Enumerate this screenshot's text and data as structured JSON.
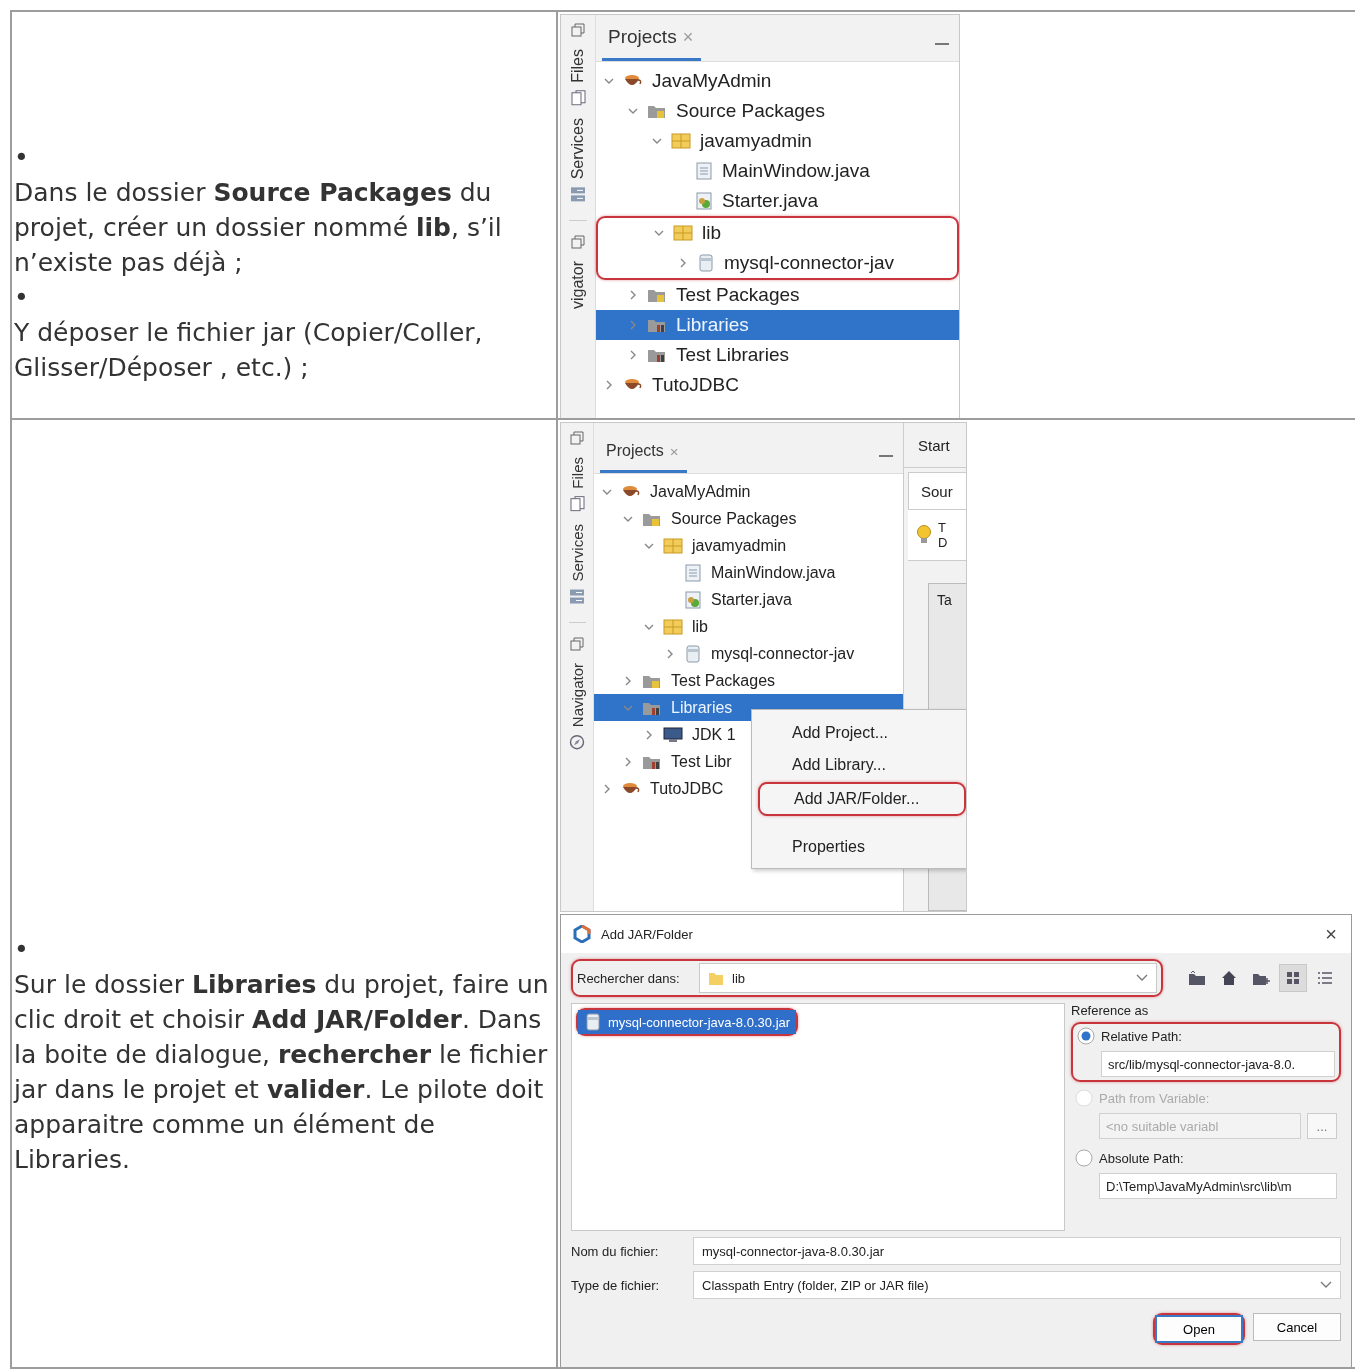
{
  "rows": [
    {
      "bullets": [
        {
          "marker": "•",
          "text": "Dans le dossier **Source Packages** du projet, créer un dossier nommé **lib**, s’il n’existe pas déjà ;"
        },
        {
          "marker": "•",
          "text": "Y déposer le fichier jar (Copier/Coller, Glisser/Déposer , etc.) ;"
        }
      ],
      "screenshots": [
        {
          "kind": "ide",
          "side_groups": [
            {
              "tabs": [
                {
                  "label": "Files",
                  "kind": "files"
                },
                {
                  "label": "Services",
                  "kind": "services"
                }
              ]
            },
            {
              "tabs": [
                {
                  "label": "vigator",
                  "kind": "plain"
                }
              ]
            }
          ],
          "panel_tab": {
            "label": "Projects",
            "close": "×"
          },
          "tree": [
            {
              "label": "JavaMyAdmin",
              "kind": "project",
              "expanded": true,
              "selected": false,
              "highlighted": false,
              "children": [
                {
                  "label": "Source Packages",
                  "kind": "source",
                  "expanded": true,
                  "selected": false,
                  "highlighted": false,
                  "children": [
                    {
                      "label": "javamyadmin",
                      "kind": "package",
                      "expanded": true,
                      "selected": false,
                      "highlighted": false,
                      "children": [
                        {
                          "label": "MainWindow.java",
                          "kind": "java",
                          "selected": false,
                          "highlighted": false
                        },
                        {
                          "label": "Starter.java",
                          "kind": "main",
                          "selected": false,
                          "highlighted": false
                        }
                      ]
                    },
                    {
                      "label": "lib",
                      "kind": "package",
                      "expanded": true,
                      "selected": false,
                      "highlighted": true,
                      "children": [
                        {
                          "label": "mysql-connector-jav",
                          "kind": "jar",
                          "expanded": false,
                          "selected": false,
                          "highlighted": false
                        }
                      ]
                    }
                  ]
                },
                {
                  "label": "Test Packages",
                  "kind": "source",
                  "expanded": false,
                  "selected": false,
                  "highlighted": false
                },
                {
                  "label": "Libraries",
                  "kind": "libraries",
                  "expanded": false,
                  "selected": true,
                  "highlighted": false
                },
                {
                  "label": "Test Libraries",
                  "kind": "libraries",
                  "expanded": false,
                  "selected": false,
                  "highlighted": false
                }
              ]
            },
            {
              "label": "TutoJDBC",
              "kind": "project",
              "expanded": false,
              "selected": false,
              "highlighted": false
            }
          ]
        }
      ]
    },
    {
      "bullets": [
        {
          "marker": "•",
          "text": "Sur le dossier **Libraries** du projet, faire un clic droit et choisir **Add JAR/Folder**. Dans la boite de dialogue, **rechercher** le fichier jar dans le projet et **valider**. Le pilote doit apparaitre comme un élément de Libraries."
        }
      ],
      "screenshots": [
        {
          "kind": "ide",
          "side_groups": [
            {
              "tabs": [
                {
                  "label": "Files",
                  "kind": "files"
                },
                {
                  "label": "Services",
                  "kind": "services"
                }
              ]
            },
            {
              "tabs": [
                {
                  "label": "Navigator",
                  "kind": "navigator"
                }
              ]
            }
          ],
          "panel_tab": {
            "label": "Projects",
            "close": "×"
          },
          "tree": [
            {
              "label": "JavaMyAdmin",
              "kind": "project",
              "expanded": true,
              "selected": false,
              "highlighted": false,
              "children": [
                {
                  "label": "Source Packages",
                  "kind": "source",
                  "expanded": true,
                  "selected": false,
                  "highlighted": false,
                  "children": [
                    {
                      "label": "javamyadmin",
                      "kind": "package",
                      "expanded": true,
                      "selected": false,
                      "highlighted": false,
                      "children": [
                        {
                          "label": "MainWindow.java",
                          "kind": "java",
                          "selected": false,
                          "highlighted": false
                        },
                        {
                          "label": "Starter.java",
                          "kind": "main",
                          "selected": false,
                          "highlighted": false
                        }
                      ]
                    },
                    {
                      "label": "lib",
                      "kind": "package",
                      "expanded": true,
                      "selected": false,
                      "highlighted": false,
                      "children": [
                        {
                          "label": "mysql-connector-jav",
                          "kind": "jar",
                          "expanded": false,
                          "selected": false,
                          "highlighted": false
                        }
                      ]
                    }
                  ]
                },
                {
                  "label": "Test Packages",
                  "kind": "source",
                  "expanded": false,
                  "selected": false,
                  "highlighted": false
                },
                {
                  "label": "Libraries",
                  "kind": "libraries",
                  "expanded": true,
                  "selected": true,
                  "highlighted": false,
                  "children": [
                    {
                      "label": "JDK 1",
                      "kind": "jdk",
                      "expanded": false,
                      "selected": false,
                      "highlighted": false
                    }
                  ]
                },
                {
                  "label": "Test Libr",
                  "kind": "libraries",
                  "expanded": false,
                  "selected": false,
                  "highlighted": false
                }
              ]
            },
            {
              "label": "TutoJDBC",
              "kind": "project",
              "expanded": false,
              "selected": false,
              "highlighted": false
            }
          ],
          "editor": {
            "tab": "Start",
            "toolbar": "Sour",
            "hint": [
              "T",
              "D"
            ],
            "form_label": "Ta"
          },
          "context_menu": [
            {
              "label": "Add Project...",
              "highlighted": false
            },
            {
              "label": "Add Library...",
              "highlighted": false
            },
            {
              "label": "Add JAR/Folder...",
              "highlighted": true
            },
            {
              "label": "Properties",
              "highlighted": false
            }
          ]
        },
        {
          "kind": "dialog",
          "title": "Add JAR/Folder",
          "close": "×",
          "look_in": {
            "label": "Rechercher dans:",
            "value": "lib",
            "highlighted": true
          },
          "toolbar": [
            {
              "kind": "up",
              "selected": false
            },
            {
              "kind": "home",
              "selected": false
            },
            {
              "kind": "new_folder",
              "selected": false
            },
            {
              "kind": "list",
              "selected": true
            },
            {
              "kind": "details",
              "selected": false
            }
          ],
          "files": [
            {
              "name": "mysql-connector-java-8.0.30.jar",
              "selected": true,
              "highlighted": true
            }
          ],
          "reference": {
            "label": "Reference as",
            "options": [
              {
                "label": "Relative Path:",
                "selected": true,
                "disabled": false,
                "highlighted": true,
                "value": "src/lib/mysql-connector-java-8.0."
              },
              {
                "label": "Path from Variable:",
                "selected": false,
                "disabled": true,
                "highlighted": false,
                "value": "<no suitable variabl",
                "button": "..."
              },
              {
                "label": "Absolute Path:",
                "selected": false,
                "disabled": false,
                "highlighted": false,
                "value": "D:\\Temp\\JavaMyAdmin\\src\\lib\\m"
              }
            ]
          },
          "filename": {
            "label": "Nom du fichier:",
            "value": "mysql-connector-java-8.0.30.jar"
          },
          "filetype": {
            "label": "Type de fichier:",
            "value": "Classpath Entry (folder, ZIP or JAR file)"
          },
          "buttons": [
            {
              "label": "Open",
              "default": true,
              "highlighted": true
            },
            {
              "label": "Cancel",
              "default": false,
              "highlighted": false
            }
          ]
        }
      ]
    }
  ]
}
